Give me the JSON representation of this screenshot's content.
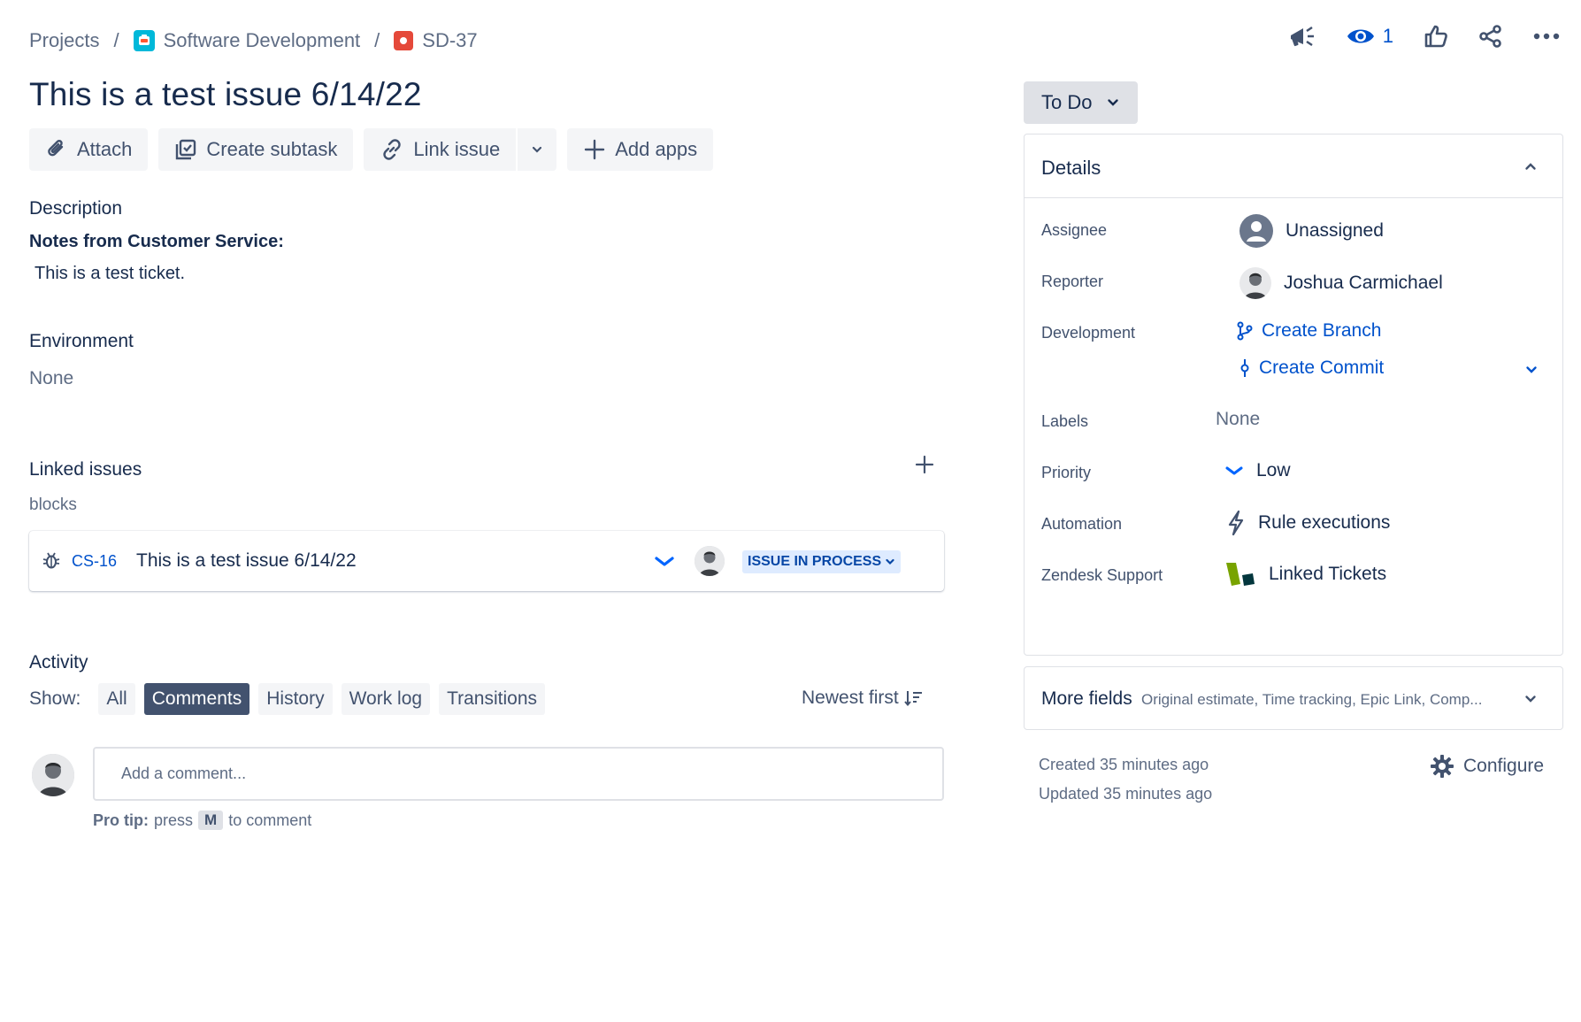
{
  "breadcrumb": {
    "projects": "Projects",
    "project_name": "Software Development",
    "issue_key": "SD-37",
    "separator": "/"
  },
  "top_actions": {
    "watch_count": "1"
  },
  "issue": {
    "title": "This is a test issue 6/14/22"
  },
  "toolbar": {
    "attach": "Attach",
    "create_subtask": "Create subtask",
    "link_issue": "Link issue",
    "add_apps": "Add apps"
  },
  "description": {
    "label": "Description",
    "bold_line": "Notes from Customer Service:",
    "text": "This is a test ticket."
  },
  "environment": {
    "label": "Environment",
    "value": "None"
  },
  "linked_issues": {
    "label": "Linked issues",
    "relation": "blocks",
    "items": [
      {
        "key": "CS-16",
        "summary": "This is a test issue 6/14/22",
        "status": "ISSUE IN PROCESS"
      }
    ]
  },
  "activity": {
    "label": "Activity",
    "show_label": "Show:",
    "filters": [
      "All",
      "Comments",
      "History",
      "Work log",
      "Transitions"
    ],
    "active_filter": "Comments",
    "sort": "Newest first",
    "comment_placeholder": "Add a comment...",
    "pro_tip_bold": "Pro tip:",
    "pro_tip_press": "press",
    "pro_tip_key": "M",
    "pro_tip_rest": "to comment"
  },
  "status": {
    "label": "To Do"
  },
  "details": {
    "title": "Details",
    "assignee_label": "Assignee",
    "assignee_value": "Unassigned",
    "reporter_label": "Reporter",
    "reporter_value": "Joshua Carmichael",
    "development_label": "Development",
    "create_branch": "Create Branch",
    "create_commit": "Create Commit",
    "labels_label": "Labels",
    "labels_value": "None",
    "priority_label": "Priority",
    "priority_value": "Low",
    "automation_label": "Automation",
    "automation_value": "Rule executions",
    "zendesk_label": "Zendesk Support",
    "zendesk_value": "Linked Tickets"
  },
  "more_fields": {
    "title": "More fields",
    "subtitle": "Original estimate, Time tracking, Epic Link, Comp..."
  },
  "meta": {
    "created": "Created 35 minutes ago",
    "updated": "Updated 35 minutes ago",
    "configure": "Configure"
  },
  "colors": {
    "link_blue": "#0052cc",
    "text_primary": "#172b4d",
    "text_secondary": "#5e6c84",
    "button_bg": "#f4f5f7",
    "active_chip": "#42526e",
    "lozenge_bg": "#deebff",
    "issue_type_red": "#e5493a",
    "project_teal": "#00b8d9"
  }
}
